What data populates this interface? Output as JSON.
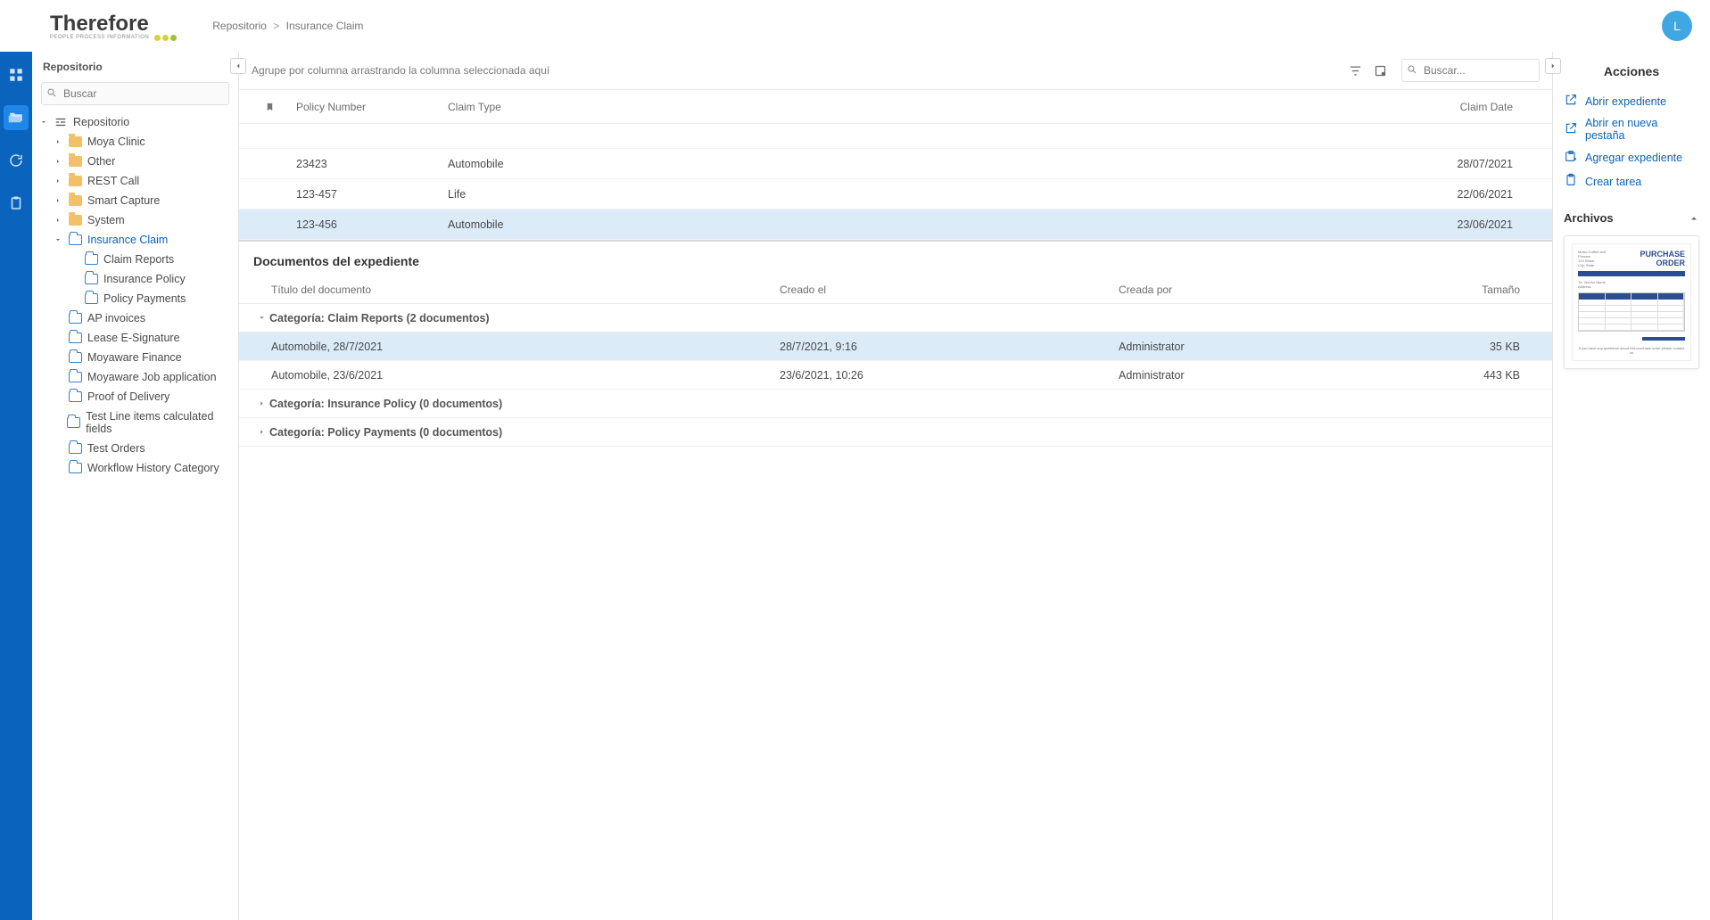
{
  "header": {
    "logo_text": "Therefore",
    "logo_tag": "PEOPLE  PROCESS  INFORMATION",
    "breadcrumb": [
      "Repositorio",
      "Insurance Claim"
    ],
    "avatar_initial": "L"
  },
  "rail": [
    {
      "name": "dashboard-icon",
      "active": false
    },
    {
      "name": "repository-icon",
      "active": true
    },
    {
      "name": "sync-icon",
      "active": false
    },
    {
      "name": "tasks-icon",
      "active": false
    }
  ],
  "tree": {
    "title": "Repositorio",
    "search_placeholder": "Buscar",
    "root": {
      "label": "Repositorio",
      "type": "root",
      "expanded": true
    },
    "items": [
      {
        "label": "Moya Clinic",
        "type": "folder",
        "depth": 1,
        "caret": true
      },
      {
        "label": "Other",
        "type": "folder",
        "depth": 1,
        "caret": true
      },
      {
        "label": "REST Call",
        "type": "folder",
        "depth": 1,
        "caret": true
      },
      {
        "label": "Smart Capture",
        "type": "folder",
        "depth": 1,
        "caret": true
      },
      {
        "label": "System",
        "type": "folder",
        "depth": 1,
        "caret": true
      },
      {
        "label": "Insurance Claim",
        "type": "case",
        "depth": 1,
        "caret": true,
        "expanded": true,
        "active": true
      },
      {
        "label": "Claim Reports",
        "type": "cat",
        "depth": 2
      },
      {
        "label": "Insurance Policy",
        "type": "cat",
        "depth": 2
      },
      {
        "label": "Policy Payments",
        "type": "cat",
        "depth": 2
      },
      {
        "label": "AP invoices",
        "type": "cat",
        "depth": 1
      },
      {
        "label": "Lease E-Signature",
        "type": "cat",
        "depth": 1
      },
      {
        "label": "Moyaware Finance",
        "type": "cat",
        "depth": 1
      },
      {
        "label": "Moyaware Job application",
        "type": "cat",
        "depth": 1
      },
      {
        "label": "Proof of Delivery",
        "type": "cat",
        "depth": 1
      },
      {
        "label": "Test Line items calculated fields",
        "type": "cat",
        "depth": 1
      },
      {
        "label": "Test Orders",
        "type": "cat",
        "depth": 1
      },
      {
        "label": "Workflow History Category",
        "type": "cat",
        "depth": 1
      }
    ]
  },
  "grid": {
    "group_hint": "Agrupe por columna arrastrando la columna seleccionada aquí",
    "search_placeholder": "Buscar...",
    "columns": {
      "policy": "Policy Number",
      "claim_type": "Claim Type",
      "claim_date": "Claim Date"
    },
    "rows": [
      {
        "policy": "23423",
        "claim_type": "Automobile",
        "claim_date": "28/07/2021",
        "selected": false
      },
      {
        "policy": "123-457",
        "claim_type": "Life",
        "claim_date": "22/06/2021",
        "selected": false
      },
      {
        "policy": "123-456",
        "claim_type": "Automobile",
        "claim_date": "23/06/2021",
        "selected": true
      }
    ]
  },
  "docs": {
    "title": "Documentos del expediente",
    "columns": {
      "title": "Título del documento",
      "created": "Creado el",
      "by": "Creada por",
      "size": "Tamaño"
    },
    "groups": [
      {
        "label": "Categoría: Claim Reports (2 documentos)",
        "expanded": true,
        "rows": [
          {
            "title": "Automobile, 28/7/2021",
            "created": "28/7/2021, 9:16",
            "by": "Administrator",
            "size": "35 KB",
            "selected": true
          },
          {
            "title": "Automobile, 23/6/2021",
            "created": "23/6/2021, 10:26",
            "by": "Administrator",
            "size": "443 KB",
            "selected": false
          }
        ]
      },
      {
        "label": "Categoría: Insurance Policy (0 documentos)",
        "expanded": false,
        "rows": []
      },
      {
        "label": "Categoría: Policy Payments (0 documentos)",
        "expanded": false,
        "rows": []
      }
    ]
  },
  "right": {
    "title": "Acciones",
    "actions": [
      {
        "name": "open-case",
        "label": "Abrir expediente",
        "icon": "external"
      },
      {
        "name": "open-new-tab",
        "label": "Abrir en nueva pestaña",
        "icon": "external"
      },
      {
        "name": "add-case",
        "label": "Agregar expediente",
        "icon": "add-case"
      },
      {
        "name": "create-task",
        "label": "Crear tarea",
        "icon": "clipboard"
      }
    ],
    "files_title": "Archivos",
    "thumb_title": "PURCHASE ORDER"
  }
}
